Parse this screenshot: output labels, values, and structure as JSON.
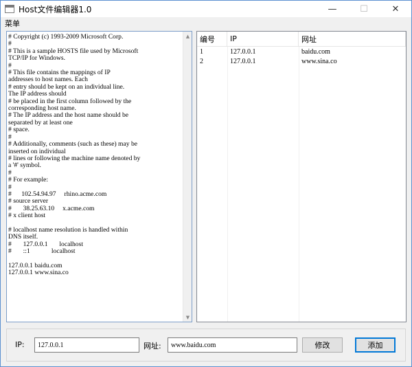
{
  "window": {
    "title": "Host文件编辑器1.0",
    "minimize": "—",
    "maximize": "☐",
    "close": "✕"
  },
  "menubar": {
    "menu": "菜单"
  },
  "editor": {
    "content": "# Copyright (c) 1993-2009 Microsoft Corp.\n#\n# This is a sample HOSTS file used by Microsoft\nTCP/IP for Windows.\n#\n# This file contains the mappings of IP\naddresses to host names. Each\n# entry should be kept on an individual line.\nThe IP address should\n# be placed in the first column followed by the\ncorresponding host name.\n# The IP address and the host name should be\nseparated by at least one\n# space.\n#\n# Additionally, comments (such as these) may be\ninserted on individual\n# lines or following the machine name denoted by\na '#' symbol.\n#\n# For example:\n#\n#      102.54.94.97     rhino.acme.com\n# source server\n#       38.25.63.10     x.acme.com\n# x client host\n\n# localhost name resolution is handled within\nDNS itself.\n#       127.0.0.1       localhost\n#       ::1             localhost\n\n127.0.0.1 baidu.com\n127.0.0.1 www.sina.co",
    "scroll_up": "▲",
    "scroll_down": "▼"
  },
  "table": {
    "headers": [
      "编号",
      "IP",
      "网址"
    ],
    "rows": [
      [
        "1",
        "127.0.0.1",
        "baidu.com"
      ],
      [
        "2",
        "127.0.0.1",
        "www.sina.co"
      ]
    ]
  },
  "form": {
    "ip_label": "IP:",
    "ip_value": "127.0.0.1",
    "url_label": "网址:",
    "url_value": "www.baidu.com",
    "modify_button": "修改",
    "add_button": "添加"
  }
}
